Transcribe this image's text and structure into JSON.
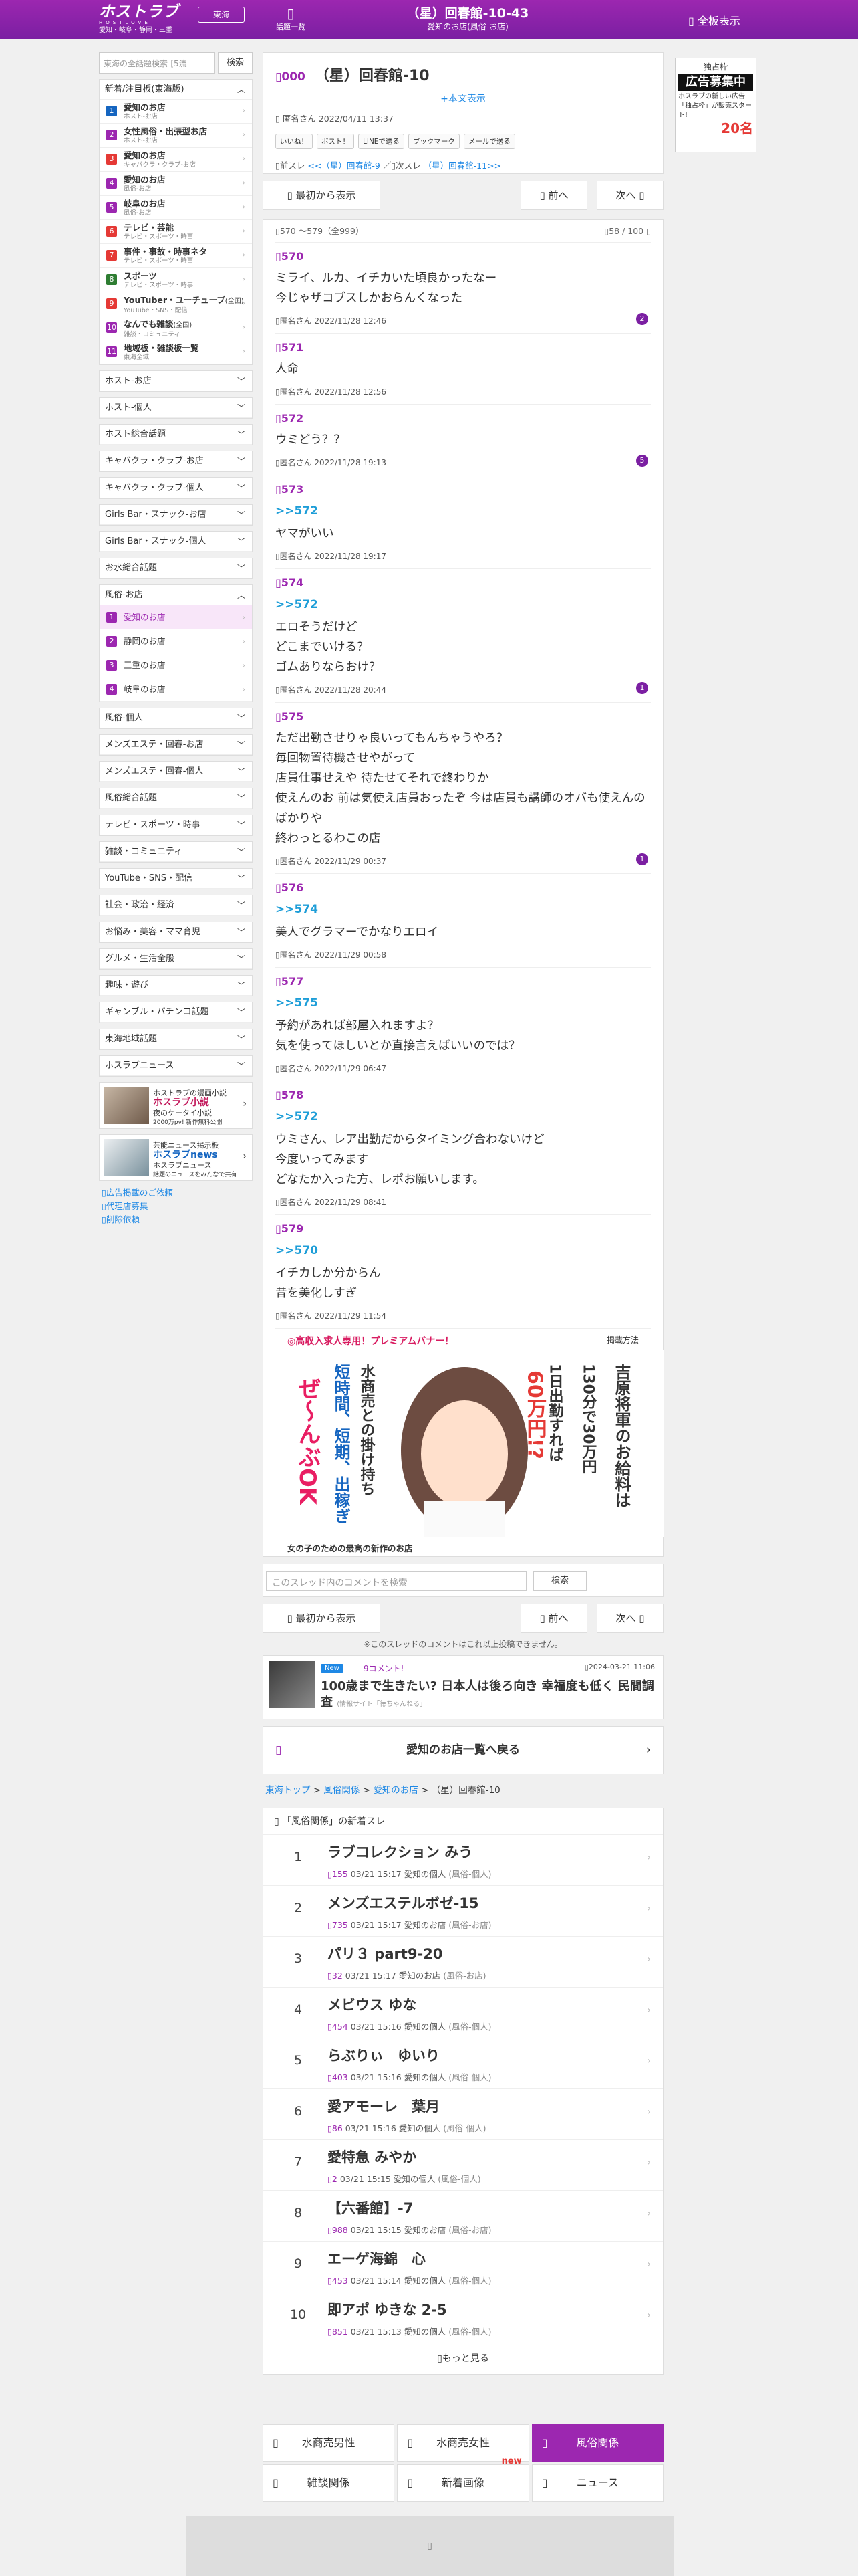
{
  "header": {
    "logo": "ホストラブ",
    "logo_sub": "HOSTLOVE",
    "logo_area": "愛知・岐阜・静岡・三重",
    "area_btn": "東海",
    "list_label": "話題一覧",
    "title": "（星）回春館-10-43",
    "subtitle": "愛知のお店(風俗-お店)",
    "all_label": "全板表示"
  },
  "sidebar": {
    "search_placeholder": "東海の全話題検索-[5流",
    "search_btn": "検索",
    "new_header": "新着/注目板(東海版)",
    "categories": [
      {
        "num": "1",
        "name": "愛知のお店",
        "sub": "ホスト-お店",
        "color": "#1565c0"
      },
      {
        "num": "2",
        "name": "女性風俗・出張型お店",
        "sub": "ホスト-お店",
        "color": "#9c27b0"
      },
      {
        "num": "3",
        "name": "愛知のお店",
        "sub": "キャバクラ・クラブ-お店",
        "color": "#e53935"
      },
      {
        "num": "4",
        "name": "愛知のお店",
        "sub": "風俗-お店",
        "color": "#9c27b0"
      },
      {
        "num": "5",
        "name": "岐阜のお店",
        "sub": "風俗-お店",
        "color": "#9c27b0"
      },
      {
        "num": "6",
        "name": "テレビ・芸能",
        "sub": "テレビ・スポーツ・時事",
        "color": "#e53935"
      },
      {
        "num": "7",
        "name": "事件・事故・時事ネタ",
        "sub": "テレビ・スポーツ・時事",
        "color": "#e53935"
      },
      {
        "num": "8",
        "name": "スポーツ",
        "sub": "テレビ・スポーツ・時事",
        "color": "#2e7d32"
      },
      {
        "num": "9",
        "name": "YouTuber・ユーチューブ",
        "sub": "YouTube・SNS・配信",
        "color": "#e53935"
      },
      {
        "num": "10",
        "name": "なんでも雑談",
        "sub": "雑談・コミュニティ",
        "color": "#9c27b0"
      },
      {
        "num": "11",
        "name": "地域板・雑談板一覧",
        "sub": "東海全域",
        "color": "#9c27b0"
      }
    ],
    "national_tag": "(全国)",
    "sections_a": [
      "ホスト-お店",
      "ホスト-個人",
      "ホスト総合話題",
      "キャバクラ・クラブ-お店",
      "キャバクラ・クラブ-個人",
      "Girls Bar・スナック-お店",
      "Girls Bar・スナック-個人",
      "お水総合話題"
    ],
    "open_section": "風俗-お店",
    "open_items": [
      {
        "num": "1",
        "label": "愛知のお店"
      },
      {
        "num": "2",
        "label": "静岡のお店"
      },
      {
        "num": "3",
        "label": "三重のお店"
      },
      {
        "num": "4",
        "label": "岐阜のお店"
      }
    ],
    "sections_b": [
      "風俗-個人",
      "メンズエステ・回春-お店",
      "メンズエステ・回春-個人",
      "風俗総合話題",
      "テレビ・スポーツ・時事",
      "雑談・コミュニティ",
      "YouTube・SNS・配信",
      "社会・政治・経済",
      "お悩み・美容・ママ育児",
      "グルメ・生活全般",
      "趣味・遊び",
      "ギャンブル・パチンコ話題",
      "東海地域話題",
      "ホスラブニュース"
    ],
    "banner1": {
      "l1": "ホストラブの漫画小説",
      "l2": "ホスラブ小説",
      "l3": "夜のケータイ小説",
      "l4": "2000万pv! 新作無料公開"
    },
    "banner2": {
      "l1": "芸能ニュース掲示板",
      "l2": "ホスラブnews",
      "l3": "ホスラブニュース",
      "l4": "話題のニュースをみんなで共有"
    },
    "links": [
      "広告掲載のご依頼",
      "代理店募集",
      "削除依頼"
    ]
  },
  "thread": {
    "no": "000",
    "title": "（星）回春館-10",
    "all_link": "+本文表示",
    "meta": "匿名さん 2022/04/11 13:37",
    "share": [
      "いいね！",
      "ポスト！",
      "LINEで送る",
      "ブックマーク",
      "メールで送る"
    ],
    "prev_label": "前スレ",
    "prev_link": "<<（星）回春館-9",
    "next_label": "次スレ",
    "next_link": "（星）回春館-11>>"
  },
  "nav": {
    "first": "最初から表示",
    "prev": "前へ",
    "next": "次へ"
  },
  "pager": {
    "range": "570 〜579（全999）",
    "count": "58 / 100"
  },
  "posts": [
    {
      "no": "570",
      "anchor": "",
      "body": "ミライ、ルカ、イチカいた頃良かったなー\n今じゃザコブスしかおらんくなった",
      "meta": "匿名さん 2022/11/28 12:46",
      "replies": "2"
    },
    {
      "no": "571",
      "anchor": "",
      "body": "人命",
      "meta": "匿名さん 2022/11/28 12:56",
      "replies": ""
    },
    {
      "no": "572",
      "anchor": "",
      "body": "ウミどう？？",
      "meta": "匿名さん 2022/11/28 19:13",
      "replies": "5"
    },
    {
      "no": "573",
      "anchor": ">>572",
      "body": "ヤマがいい",
      "meta": "匿名さん 2022/11/28 19:17",
      "replies": ""
    },
    {
      "no": "574",
      "anchor": ">>572",
      "body": "エロそうだけど\nどこまでいける？\nゴムありならおけ？",
      "meta": "匿名さん 2022/11/28 20:44",
      "replies": "1"
    },
    {
      "no": "575",
      "anchor": "",
      "body": "ただ出勤させりゃ良いってもんちゃうやろ？\n毎回物置待機させやがって\n店員仕事せえや 待たせてそれで終わりか\n使えんのお 前は気使え店員おったぞ 今は店員も講師のオバも使えんのばかりや\n終わっとるわこの店",
      "meta": "匿名さん 2022/11/29 00:37",
      "replies": "1"
    },
    {
      "no": "576",
      "anchor": ">>574",
      "body": "美人でグラマーでかなりエロイ",
      "meta": "匿名さん 2022/11/29 00:58",
      "replies": ""
    },
    {
      "no": "577",
      "anchor": ">>575",
      "body": "予約があれば部屋入れますよ？\n気を使ってほしいとか直接言えばいいのでは？",
      "meta": "匿名さん 2022/11/29 06:47",
      "replies": ""
    },
    {
      "no": "578",
      "anchor": ">>572",
      "body": "ウミさん、レア出勤だからタイミング合わないけど\n今度いってみます\nどなたか入った方、レポお願いします。",
      "meta": "匿名さん 2022/11/29 08:41",
      "replies": ""
    },
    {
      "no": "579",
      "anchor": ">>570",
      "body": "イチカしか分からん\n昔を美化しすぎ",
      "meta": "匿名さん 2022/11/29 11:54",
      "replies": ""
    }
  ],
  "premium": {
    "header": "高収入求人専用！プレミアムバナー！",
    "how": "掲載方法",
    "caption": "女の子のための最高の新作のお店",
    "text_a": "ぜ〜んぶOK",
    "text_b": "水商売との掛け持ち",
    "text_c": "短時間、短期、出稼ぎ",
    "text_d": "1日出勤すれば",
    "text_e": "60万円!?",
    "text_f": "130分で30万円",
    "text_g": "吉原将軍のお給料は"
  },
  "comment_search": {
    "placeholder": "このスレッド内のコメントを検索",
    "btn": "検索"
  },
  "notice": "※このスレッドのコメントはこれ以上投稿できません。",
  "news": {
    "badge": "New",
    "comments": "9コメント!",
    "date": "2024-03-21 11:06",
    "headline": "100歳まで生きたい? 日本人は後ろ向き 幸福度も低く 民間調査",
    "source": "(情報サイト「徳ちゃんねる」"
  },
  "back_label": "愛知のお店一覧へ戻る",
  "breadcrumb": [
    "東海トップ",
    "風俗関係",
    "愛知のお店",
    "（星）回春館-10"
  ],
  "ranking": {
    "header": "「風俗関係」の新着スレ",
    "items": [
      {
        "rank": "1",
        "title": "ラブコレクション みう",
        "count": "155",
        "date": "03/21 15:17",
        "board": "愛知の個人",
        "group": "(風俗-個人)"
      },
      {
        "rank": "2",
        "title": "メンズエステルボゼ-15",
        "count": "735",
        "date": "03/21 15:17",
        "board": "愛知のお店",
        "group": "(風俗-お店)"
      },
      {
        "rank": "3",
        "title": "パリ３ part9-20",
        "count": "32",
        "date": "03/21 15:17",
        "board": "愛知のお店",
        "group": "(風俗-お店)"
      },
      {
        "rank": "4",
        "title": "メビウス ゆな",
        "count": "454",
        "date": "03/21 15:16",
        "board": "愛知の個人",
        "group": "(風俗-個人)"
      },
      {
        "rank": "5",
        "title": "らぶりぃ　ゆいり",
        "count": "403",
        "date": "03/21 15:16",
        "board": "愛知の個人",
        "group": "(風俗-個人)"
      },
      {
        "rank": "6",
        "title": "愛アモーレ　葉月",
        "count": "86",
        "date": "03/21 15:16",
        "board": "愛知の個人",
        "group": "(風俗-個人)"
      },
      {
        "rank": "7",
        "title": "愛特急 みやか",
        "count": "2",
        "date": "03/21 15:15",
        "board": "愛知の個人",
        "group": "(風俗-個人)"
      },
      {
        "rank": "8",
        "title": "【六番館】-7",
        "count": "988",
        "date": "03/21 15:15",
        "board": "愛知のお店",
        "group": "(風俗-お店)"
      },
      {
        "rank": "9",
        "title": "エーゲ海錦　心",
        "count": "453",
        "date": "03/21 15:14",
        "board": "愛知の個人",
        "group": "(風俗-個人)"
      },
      {
        "rank": "10",
        "title": "即アポ ゆきな 2-5",
        "count": "851",
        "date": "03/21 15:13",
        "board": "愛知の個人",
        "group": "(風俗-個人)"
      }
    ],
    "more": "もっと見る"
  },
  "tabs": [
    {
      "label": "水商売男性",
      "active": false,
      "new": ""
    },
    {
      "label": "水商売女性",
      "active": false,
      "new": ""
    },
    {
      "label": "風俗関係",
      "active": true,
      "new": ""
    },
    {
      "label": "雑談関係",
      "active": false,
      "new": ""
    },
    {
      "label": "新着画像",
      "active": false,
      "new": "new"
    },
    {
      "label": "ニュース",
      "active": false,
      "new": ""
    }
  ],
  "right_ad": {
    "a1": "独占枠",
    "a2": "広告募集中",
    "a3": "ホスラブの新しい広告「独占枠」が販売スタート!",
    "a4": "20名"
  },
  "colors": {
    "accent": "#9c27b0",
    "link": "#1e88e5",
    "anchor": "#1e9ed8"
  }
}
